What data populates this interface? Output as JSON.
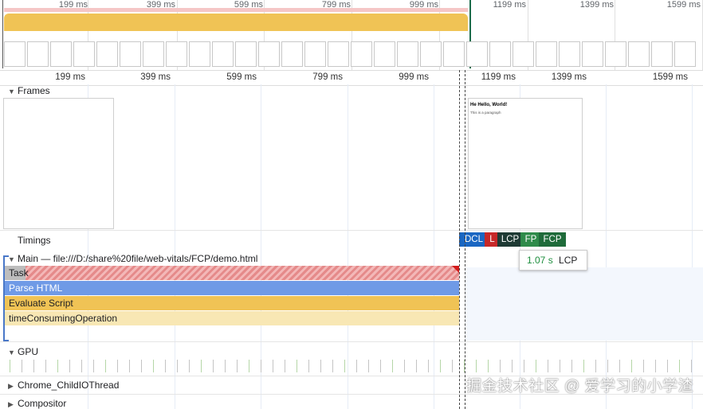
{
  "overview": {
    "ticks": [
      "199 ms",
      "399 ms",
      "599 ms",
      "799 ms",
      "999 ms",
      "1199 ms",
      "1399 ms",
      "1599 ms"
    ]
  },
  "ruler": {
    "ticks": [
      "199 ms",
      "399 ms",
      "599 ms",
      "799 ms",
      "999 ms",
      "1199 ms",
      "1399 ms",
      "1599 ms"
    ]
  },
  "tracks": {
    "frames": "Frames",
    "timings": "Timings",
    "main": "Main — file:///D:/share%20file/web-vitals/FCP/demo.html",
    "gpu": "GPU",
    "chrome_child_io": "Chrome_ChildIOThread",
    "compositor": "Compositor"
  },
  "frame_preview": {
    "heading": "Hello, World!",
    "prefix": "He",
    "body": "This is a paragraph"
  },
  "timings": [
    {
      "label": "DCL",
      "color": "#1a66c2"
    },
    {
      "label": "L",
      "color": "#c62828"
    },
    {
      "label": "LCP",
      "color": "#1e3a34"
    },
    {
      "label": "FP",
      "color": "#2e8b4a"
    },
    {
      "label": "FCP",
      "color": "#1f6b3a"
    }
  ],
  "tooltip": {
    "value": "1.07 s",
    "label": "LCP"
  },
  "main_thread": {
    "task": "Task",
    "parse": "Parse HTML",
    "evaluate": "Evaluate Script",
    "fn": "timeConsumingOperation"
  },
  "watermark": "掘金技术社区 @ 爱学习的小学渣"
}
